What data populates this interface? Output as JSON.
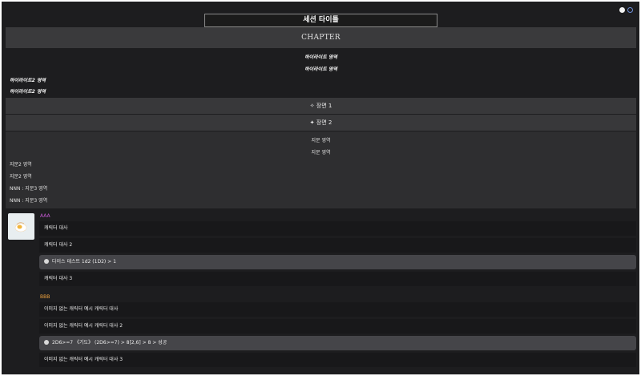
{
  "title": "세션 타이틀",
  "chapter": "CHAPTER",
  "highlights_center": [
    "하이라이트 영역",
    "하이라이트 영역"
  ],
  "highlights_left": [
    "하이라이트2 영역",
    "하이라이트2 영역"
  ],
  "scenes": [
    "✧ 장면 1",
    "✦ 장면 2"
  ],
  "narration_center": [
    "지문 영역",
    "지문 영역"
  ],
  "narration_left": [
    "지문2 영역",
    "지문2 영역",
    "NNN : 지문3 영역",
    "NNN : 지문3 영역"
  ],
  "characters": [
    {
      "name": "AAA",
      "color": "#c85ad6",
      "has_avatar": true,
      "lines": [
        {
          "type": "dialogue",
          "text": "캐릭터 대사"
        },
        {
          "type": "dialogue",
          "text": "캐릭터 대사 2"
        },
        {
          "type": "dice",
          "text": "다이스 테스트 1d2 (1D2) > 1"
        },
        {
          "type": "dialogue",
          "text": "캐릭터 대사 3"
        }
      ]
    },
    {
      "name": "BBB",
      "color": "#f0a33e",
      "has_avatar": false,
      "lines": [
        {
          "type": "dialogue",
          "text": "이미지 없는 캐릭터 예시 캐릭터 대사"
        },
        {
          "type": "dialogue",
          "text": "이미지 없는 캐릭터 예시 캐릭터 대사 2"
        },
        {
          "type": "dice",
          "text": "2D6>=7 《기도》 (2D6>=7) > 8[2,6] > 8 > 성공"
        },
        {
          "type": "dialogue",
          "text": "이미지 없는 캐릭터 예시 캐릭터 대사 3"
        }
      ]
    }
  ],
  "colors": {
    "background": "#1d1d1f",
    "chapter_bar": "#3a3a3c",
    "scene_bar": "#38383a",
    "narration_block": "#2e2e30",
    "dialogue_bubble": "#18181a",
    "dice_bubble": "#454549"
  }
}
